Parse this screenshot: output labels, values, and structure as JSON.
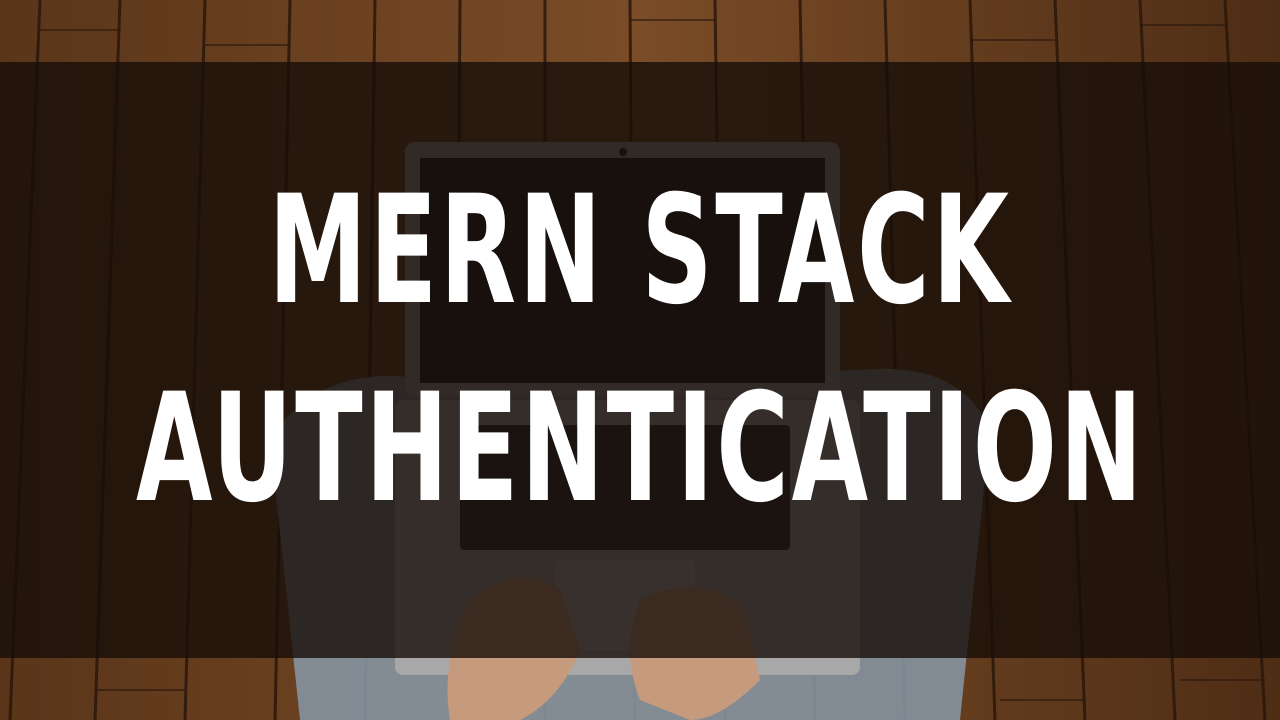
{
  "title": {
    "line1": "MERN STACK",
    "line2": "AUTHENTICATION"
  },
  "colors": {
    "text": "#ffffff",
    "overlay": "#160e09",
    "wood_light": "#8a5a33",
    "wood_dark": "#3a2414"
  },
  "background": {
    "scene": "person-typing-on-laptop-on-wooden-floor"
  }
}
